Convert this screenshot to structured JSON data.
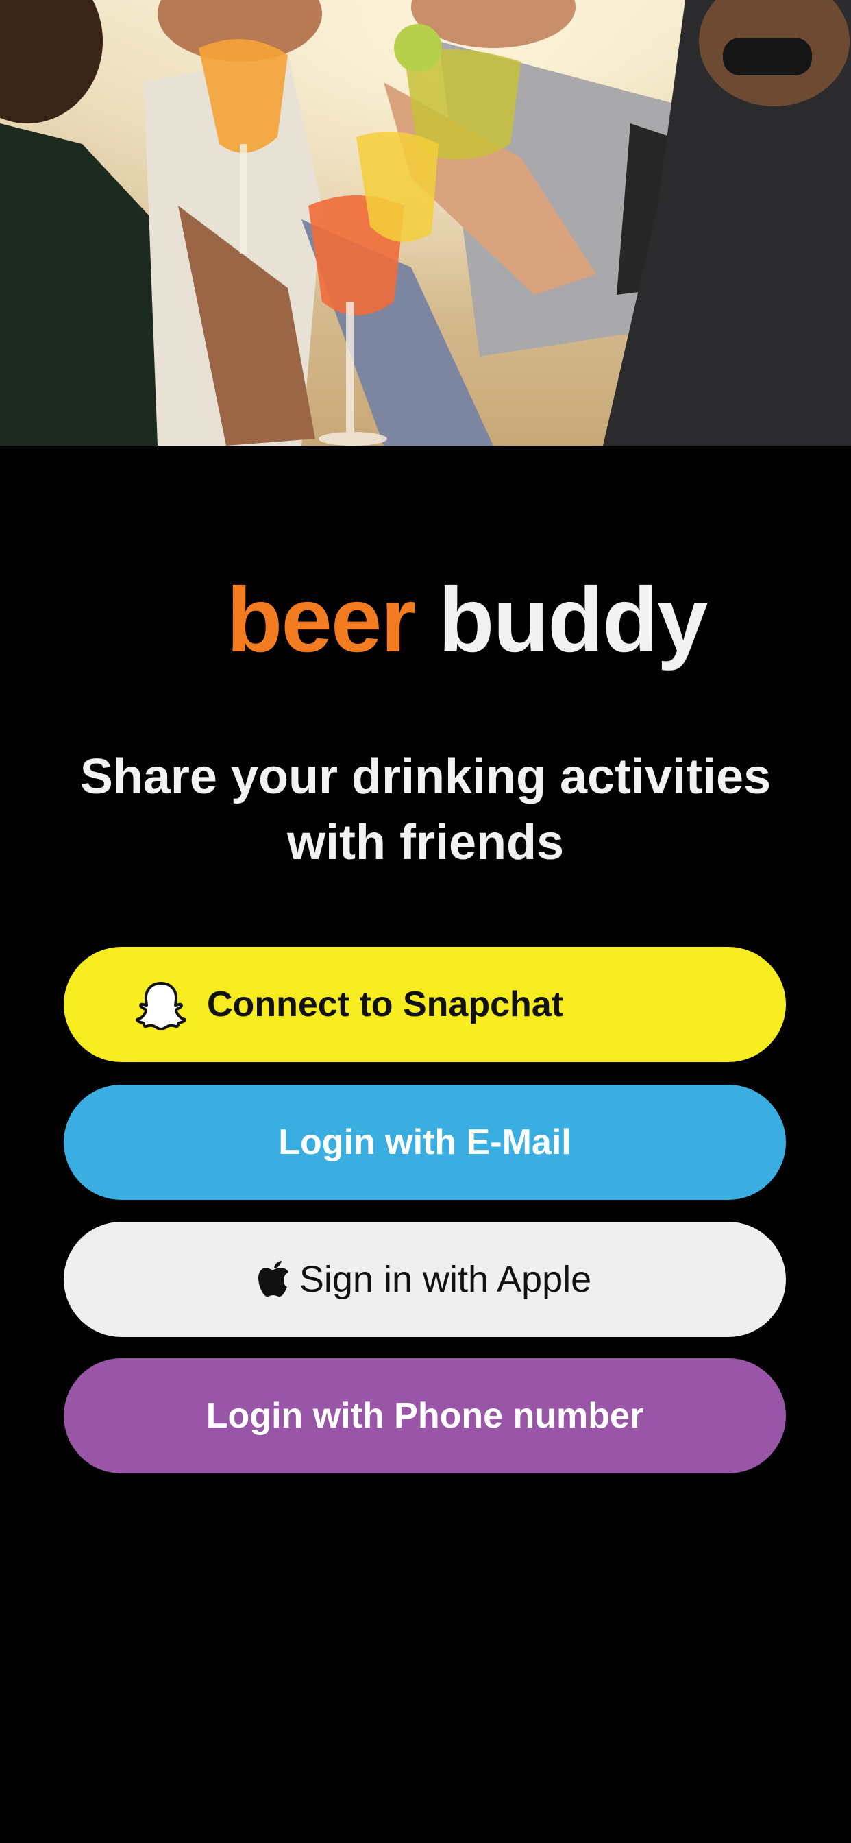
{
  "logo": {
    "word1": "beer",
    "word2": "buddy"
  },
  "tagline": {
    "line1": "Share your drinking activities",
    "line2": "with friends"
  },
  "buttons": {
    "snapchat": "Connect to Snapchat",
    "email": "Login with E-Mail",
    "apple": "Sign in with Apple",
    "phone": "Login with Phone number"
  },
  "icons": {
    "snapchat": "snapchat-ghost-icon",
    "apple": "apple-logo-icon"
  },
  "colors": {
    "logo_beer": "#f47c20",
    "logo_buddy": "#f2f2f2",
    "snapchat_button": "#f7ec1f",
    "email_button": "#3aaee0",
    "apple_button": "#efefef",
    "phone_button": "#9a56a6",
    "background": "#000000"
  }
}
